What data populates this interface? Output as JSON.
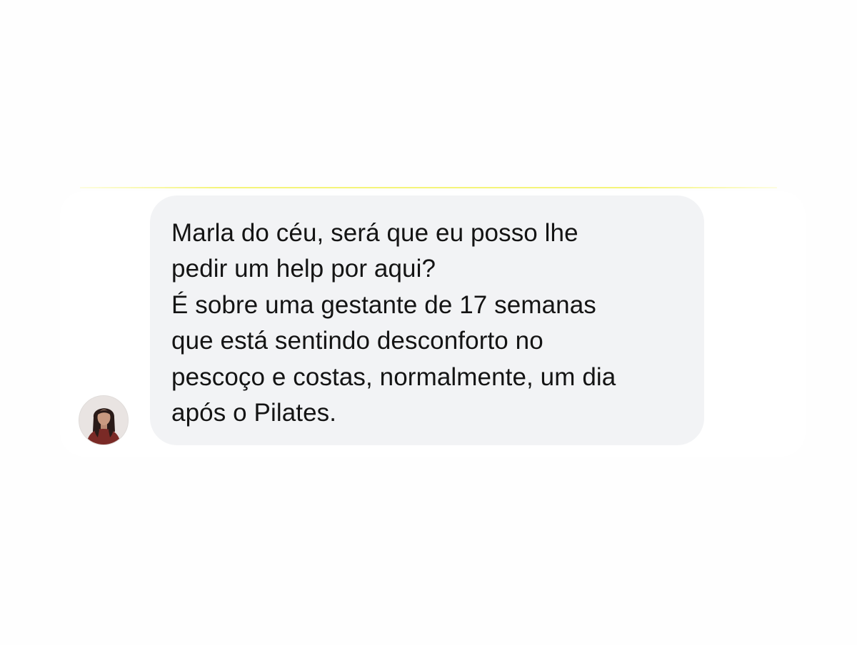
{
  "chat": {
    "sender": {
      "avatar_icon": "user-avatar-photo"
    },
    "message": {
      "lines": [
        "Marla do céu, será que eu posso lhe",
        "pedir um help por aqui?",
        "É sobre uma gestante de 17 semanas",
        "que está sentindo desconforto no",
        "pescoço e costas, normalmente, um dia",
        "após o Pilates."
      ]
    },
    "colors": {
      "bubble_background": "#f2f3f5",
      "text": "#141414",
      "accent_border": "#f4f47a"
    }
  }
}
